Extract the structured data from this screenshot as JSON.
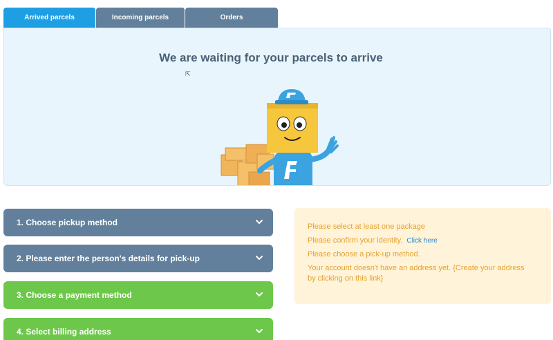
{
  "tabs": [
    {
      "label": "Arrived parcels"
    },
    {
      "label": "Incoming parcels"
    },
    {
      "label": "Orders"
    }
  ],
  "hero": {
    "title": "We are waiting for your parcels to arrive"
  },
  "steps": [
    {
      "label": "1. Choose pickup method",
      "color": "#62809b"
    },
    {
      "label": "2. Please enter the person's details for pick-up",
      "color": "#62809b"
    },
    {
      "label": "3. Choose a payment method",
      "color": "#6dc74a"
    },
    {
      "label": "4. Select billing address",
      "color": "#6dc74a"
    }
  ],
  "notice": {
    "select_package": "Please select at least one package",
    "confirm_identity": "Please confirm your identity.",
    "click_here": "Click here",
    "pickup_method": "Please choose a pick-up method.",
    "no_address": "Your account doesn't have an address yet. {Create your address by clicking on this link}"
  },
  "colors": {
    "accent": "#1e9fe3",
    "tab_inactive": "#62809b",
    "notice_text": "#e6a12c",
    "notice_bg": "#fff3d9"
  }
}
